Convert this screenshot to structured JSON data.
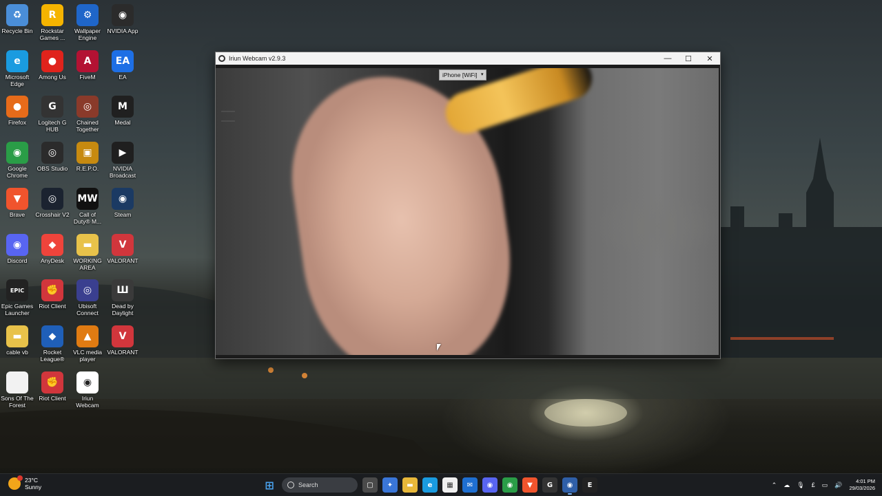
{
  "desktop_icons": [
    {
      "label": "Recycle Bin",
      "icon": "recycle-bin-icon",
      "color": "#4a8ed8",
      "glyph": "♻"
    },
    {
      "label": "Rockstar Games ...",
      "icon": "rockstar-icon",
      "color": "#f5b400",
      "glyph": "R"
    },
    {
      "label": "Wallpaper Engine",
      "icon": "wallpaper-engine-icon",
      "color": "#1f66c9",
      "glyph": "⚙"
    },
    {
      "label": "NVIDIA App",
      "icon": "nvidia-icon",
      "color": "#2b2b2b",
      "glyph": "◉"
    },
    {
      "label": "Microsoft Edge",
      "icon": "edge-icon",
      "color": "#1a9be0",
      "glyph": "e"
    },
    {
      "label": "Among Us",
      "icon": "among-us-icon",
      "color": "#e0231c",
      "glyph": "●"
    },
    {
      "label": "FiveM",
      "icon": "fivem-icon",
      "color": "#b31233",
      "glyph": "A"
    },
    {
      "label": "EA",
      "icon": "ea-icon",
      "color": "#1e6fe5",
      "glyph": "EA"
    },
    {
      "label": "Firefox",
      "icon": "firefox-icon",
      "color": "#e66b1a",
      "glyph": "●"
    },
    {
      "label": "Logitech G HUB",
      "icon": "logitech-icon",
      "color": "#333333",
      "glyph": "G"
    },
    {
      "label": "Chained Together",
      "icon": "chained-together-icon",
      "color": "#8a3a2a",
      "glyph": "◎"
    },
    {
      "label": "Medal",
      "icon": "medal-icon",
      "color": "#202020",
      "glyph": "M"
    },
    {
      "label": "Google Chrome",
      "icon": "chrome-icon",
      "color": "#2a9d47",
      "glyph": "◉"
    },
    {
      "label": "OBS Studio",
      "icon": "obs-icon",
      "color": "#2b2b2b",
      "glyph": "◎"
    },
    {
      "label": "R.E.P.O.",
      "icon": "repo-icon",
      "color": "#c78a10",
      "glyph": "▣"
    },
    {
      "label": "NVIDIA Broadcast",
      "icon": "nvidia-broadcast-icon",
      "color": "#1f1f1f",
      "glyph": "▶"
    },
    {
      "label": "Brave",
      "icon": "brave-icon",
      "color": "#f0542d",
      "glyph": "▼"
    },
    {
      "label": "Crosshair V2",
      "icon": "crosshair-icon",
      "color": "#1b2330",
      "glyph": "◎"
    },
    {
      "label": "Call of Duty® M...",
      "icon": "call-of-duty-icon",
      "color": "#111111",
      "glyph": "MW"
    },
    {
      "label": "Steam",
      "icon": "steam-icon",
      "color": "#1b3a63",
      "glyph": "◉"
    },
    {
      "label": "Discord",
      "icon": "discord-icon",
      "color": "#5865f2",
      "glyph": "◉"
    },
    {
      "label": "AnyDesk",
      "icon": "anydesk-icon",
      "color": "#ef443b",
      "glyph": "◆"
    },
    {
      "label": "WORKING AREA",
      "icon": "folder-icon",
      "color": "#e8c24a",
      "glyph": "▬"
    },
    {
      "label": "VALORANT",
      "icon": "valorant-icon",
      "color": "#d1363c",
      "glyph": "V"
    },
    {
      "label": "Epic Games Launcher",
      "icon": "epic-games-icon",
      "color": "#222222",
      "glyph": "EPIC"
    },
    {
      "label": "Riot Client",
      "icon": "riot-client-icon",
      "color": "#d1363c",
      "glyph": "✊"
    },
    {
      "label": "Ubisoft Connect",
      "icon": "ubisoft-icon",
      "color": "#3a3f8f",
      "glyph": "◎"
    },
    {
      "label": "Dead by Daylight",
      "icon": "dead-by-daylight-icon",
      "color": "#3a3a3a",
      "glyph": "Ш"
    },
    {
      "label": "cable vb",
      "icon": "folder-icon",
      "color": "#e8c24a",
      "glyph": "▬"
    },
    {
      "label": "Rocket League®",
      "icon": "rocket-league-icon",
      "color": "#1f5fb8",
      "glyph": "◆"
    },
    {
      "label": "VLC media player",
      "icon": "vlc-icon",
      "color": "#e07b12",
      "glyph": "▲"
    },
    {
      "label": "VALORANT",
      "icon": "valorant-icon",
      "color": "#d1363c",
      "glyph": "V"
    },
    {
      "label": "Sons Of The Forest",
      "icon": "file-icon",
      "color": "#f2f2f2",
      "glyph": ""
    },
    {
      "label": "Riot Client",
      "icon": "riot-client-icon",
      "color": "#d1363c",
      "glyph": "✊"
    },
    {
      "label": "Iriun Webcam",
      "icon": "iriun-webcam-icon",
      "color": "#ffffff",
      "glyph": "◉"
    }
  ],
  "window": {
    "title": "Iriun Webcam v2.9.3",
    "device": "iPhone [WiFi]"
  },
  "taskbar": {
    "weather_temp": "23°C",
    "weather_desc": "Sunny",
    "search_placeholder": "Search",
    "pinned": [
      {
        "name": "file-explorer-icon",
        "color": "#4a4a4a",
        "glyph": "▢"
      },
      {
        "name": "copilot-icon",
        "color": "#3a76d8",
        "glyph": "✦"
      },
      {
        "name": "folder-icon",
        "color": "#e8b83a",
        "glyph": "▬"
      },
      {
        "name": "edge-icon",
        "color": "#1a9be0",
        "glyph": "e"
      },
      {
        "name": "store-icon",
        "color": "#f0f0f0",
        "glyph": "▦"
      },
      {
        "name": "outlook-icon",
        "color": "#1f6fd1",
        "glyph": "✉"
      },
      {
        "name": "discord-icon",
        "color": "#5865f2",
        "glyph": "◉"
      },
      {
        "name": "chrome-icon",
        "color": "#2a9d47",
        "glyph": "◉"
      },
      {
        "name": "brave-icon",
        "color": "#f0542d",
        "glyph": "▼"
      },
      {
        "name": "logitech-icon",
        "color": "#333333",
        "glyph": "G"
      },
      {
        "name": "iriun-webcam-icon",
        "color": "#2f5fa8",
        "glyph": "◉"
      },
      {
        "name": "epic-games-icon",
        "color": "#222222",
        "glyph": "E"
      }
    ],
    "time": "4:01 PM",
    "date": "29/03/2026",
    "lang": "£"
  }
}
